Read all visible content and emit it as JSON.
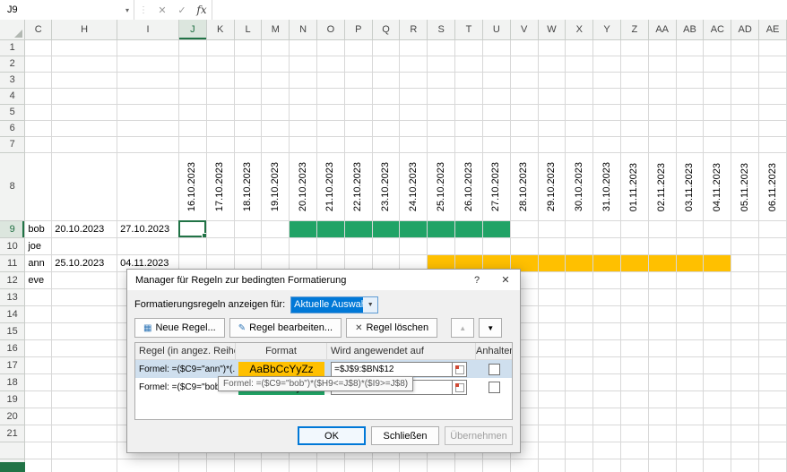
{
  "formula_bar": {
    "name_box": "J9",
    "dropdown_icon": "▾",
    "dots_icon": "⋮",
    "cancel_icon": "✕",
    "confirm_icon": "✓",
    "fx_icon": "fx",
    "formula_value": ""
  },
  "grid": {
    "columns": [
      "C",
      "H",
      "I",
      "J",
      "K",
      "L",
      "M",
      "N",
      "O",
      "P",
      "Q",
      "R",
      "S",
      "T",
      "U",
      "V",
      "W",
      "X",
      "Y",
      "Z",
      "AA",
      "AB",
      "AC",
      "AD",
      "AE"
    ],
    "row_labels": [
      "1",
      "2",
      "3",
      "4",
      "5",
      "6",
      "7",
      "8",
      "9",
      "10",
      "11",
      "12",
      "13",
      "14",
      "15",
      "16",
      "17",
      "18",
      "19",
      "20",
      "21"
    ],
    "dates": [
      "16.10.2023",
      "17.10.2023",
      "18.10.2023",
      "19.10.2023",
      "20.10.2023",
      "21.10.2023",
      "22.10.2023",
      "23.10.2023",
      "24.10.2023",
      "25.10.2023",
      "26.10.2023",
      "27.10.2023",
      "28.10.2023",
      "29.10.2023",
      "30.10.2023",
      "31.10.2023",
      "01.11.2023",
      "02.11.2023",
      "03.11.2023",
      "04.11.2023",
      "05.11.2023",
      "06.11.2023"
    ],
    "cells": {
      "C9": "bob",
      "H9": "20.10.2023",
      "I9": "27.10.2023",
      "C10": "joe",
      "C11": "ann",
      "H11": "25.10.2023",
      "I11": "04.11.2023",
      "C12": "eve"
    },
    "highlights": [
      {
        "row": 9,
        "from": "N",
        "to": "U",
        "color": "#21A366"
      },
      {
        "row": 11,
        "from": "S",
        "to": "AC",
        "color": "#FFC000"
      }
    ],
    "selection": {
      "cell": "J9",
      "col": "J",
      "row": 9
    },
    "colors": {
      "selection_border": "#217346",
      "gridline": "#d8d8d8"
    }
  },
  "dialog": {
    "title": "Manager für Regeln zur bedingten Formatierung",
    "help_icon": "?",
    "close_icon": "✕",
    "scope_label": "Formatierungsregeln anzeigen für:",
    "scope_value": "Aktuelle Auswahl",
    "dropdown_icon": "▼",
    "new_rule_icon": "▦",
    "new_rule_button": "Neue Regel...",
    "edit_rule_icon": "✎",
    "edit_rule_button": "Regel bearbeiten...",
    "delete_rule_icon": "✕",
    "delete_rule_button": "Regel löschen",
    "move_up_icon": "▲",
    "move_down_icon": "▼",
    "table_headers": [
      "Regel (in angez. Reihenfolge)",
      "Format",
      "Wird angewendet auf",
      "Anhalten"
    ],
    "rules": [
      {
        "formula": "Formel: =($C9=\"ann\")*(...",
        "preview": "AaBbCcYyZz",
        "color": "#FFC000",
        "applies": "=$J$9:$BN$12"
      },
      {
        "formula": "Formel: =($C9=\"bob\")*(...",
        "preview": "AaBbCcYyZz",
        "color": "#21A366",
        "applies": "=$J$9:$BN$12"
      }
    ],
    "tooltip": "Formel: =($C9=\"bob\")*($H9<=J$8)*($I9>=J$8)",
    "ok_button": "OK",
    "close_button": "Schließen",
    "apply_button": "Übernehmen"
  }
}
